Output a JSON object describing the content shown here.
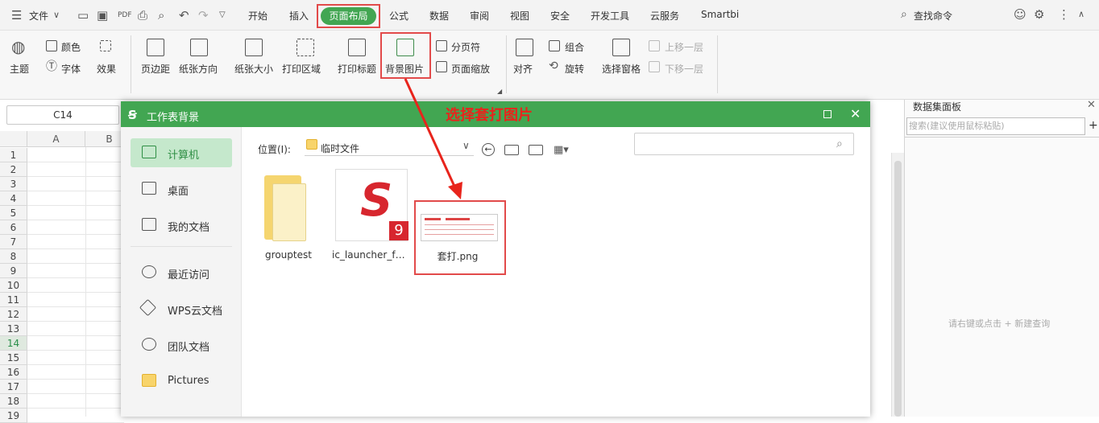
{
  "menubar": {
    "file": "文件",
    "tabs": [
      "开始",
      "插入",
      "页面布局",
      "公式",
      "数据",
      "审阅",
      "视图",
      "安全",
      "开发工具",
      "云服务",
      "Smartbi"
    ],
    "active_tab": "页面布局",
    "search": "查找命令"
  },
  "ribbon": {
    "theme": "主题",
    "colors": "颜色",
    "fonts": "字体",
    "effects": "效果",
    "margins": "页边距",
    "orientation": "纸张方向",
    "size": "纸张大小",
    "print_area": "打印区域",
    "print_titles": "打印标题",
    "background": "背景图片",
    "page_break": "分页符",
    "page_zoom": "页面缩放",
    "align": "对齐",
    "group": "组合",
    "rotate": "旋转",
    "selection_pane": "选择窗格",
    "bring_forward": "上移一层",
    "send_backward": "下移一层"
  },
  "sheet": {
    "name_box": "C14",
    "columns": [
      "A",
      "B"
    ],
    "rows": [
      "1",
      "2",
      "3",
      "4",
      "5",
      "6",
      "7",
      "8",
      "9",
      "10",
      "11",
      "12",
      "13",
      "14",
      "15",
      "16",
      "17",
      "18",
      "19"
    ],
    "selected_row": "14"
  },
  "annotation": {
    "text": "选择套打图片",
    "color": "#e8241c"
  },
  "dialog": {
    "title": "工作表背景",
    "location_label": "位置(I):",
    "location_value": "临时文件",
    "sidebar": [
      "计算机",
      "桌面",
      "我的文档",
      "最近访问",
      "WPS云文档",
      "团队文档",
      "Pictures"
    ],
    "files": [
      {
        "name": "grouptest",
        "icon": "folder-icon"
      },
      {
        "name": "ic_launcher_for...",
        "icon": "s9-app-icon"
      },
      {
        "name": "套打.png",
        "icon": "image-thumbnail"
      }
    ]
  },
  "pane": {
    "title": "数据集面板",
    "search_placeholder": "搜索(建议使用鼠标粘贴)",
    "empty_hint": "请右键或点击 + 新建查询"
  },
  "colors": {
    "accent": "#42a652",
    "highlight": "#e24a4a"
  }
}
